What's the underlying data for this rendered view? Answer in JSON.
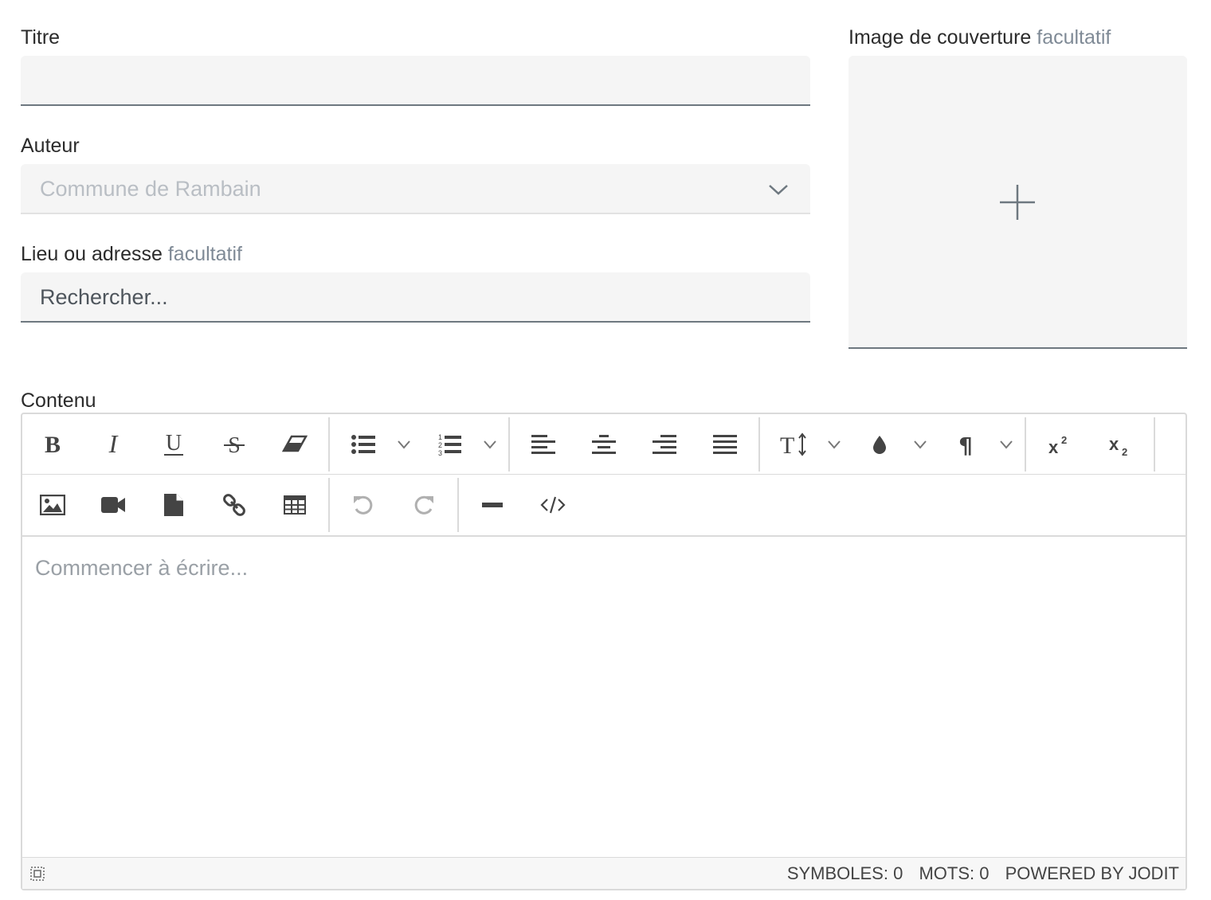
{
  "form": {
    "title_label": "Titre",
    "title_value": "",
    "author_label": "Auteur",
    "author_value": "Commune de Rambain",
    "location_label": "Lieu ou adresse",
    "location_optional": "facultatif",
    "location_placeholder": "Rechercher...",
    "cover_label": "Image de couverture",
    "cover_optional": "facultatif",
    "content_label": "Contenu"
  },
  "editor": {
    "toolbar_row1": [
      "bold-icon",
      "italic-icon",
      "underline-icon",
      "strikethrough-icon",
      "eraser-icon",
      "bullet-list-icon",
      "numbered-list-icon",
      "align-left-icon",
      "align-center-icon",
      "align-right-icon",
      "align-justify-icon",
      "font-size-icon",
      "text-color-icon",
      "paragraph-icon",
      "superscript-icon",
      "subscript-icon"
    ],
    "toolbar_row2": [
      "image-icon",
      "video-icon",
      "file-icon",
      "link-icon",
      "table-icon",
      "undo-icon",
      "redo-icon",
      "horizontal-rule-icon",
      "source-code-icon"
    ],
    "placeholder": "Commencer à écrire...",
    "status": {
      "symbols": "SYMBOLES: 0",
      "words": "MOTS: 0",
      "powered": "POWERED BY JODIT"
    }
  },
  "colors": {
    "field_bg": "#f5f5f5",
    "field_border": "#6e7880",
    "optional_text": "#7f8a96",
    "icon": "#444444",
    "icon_disabled": "#b0b0b0"
  }
}
